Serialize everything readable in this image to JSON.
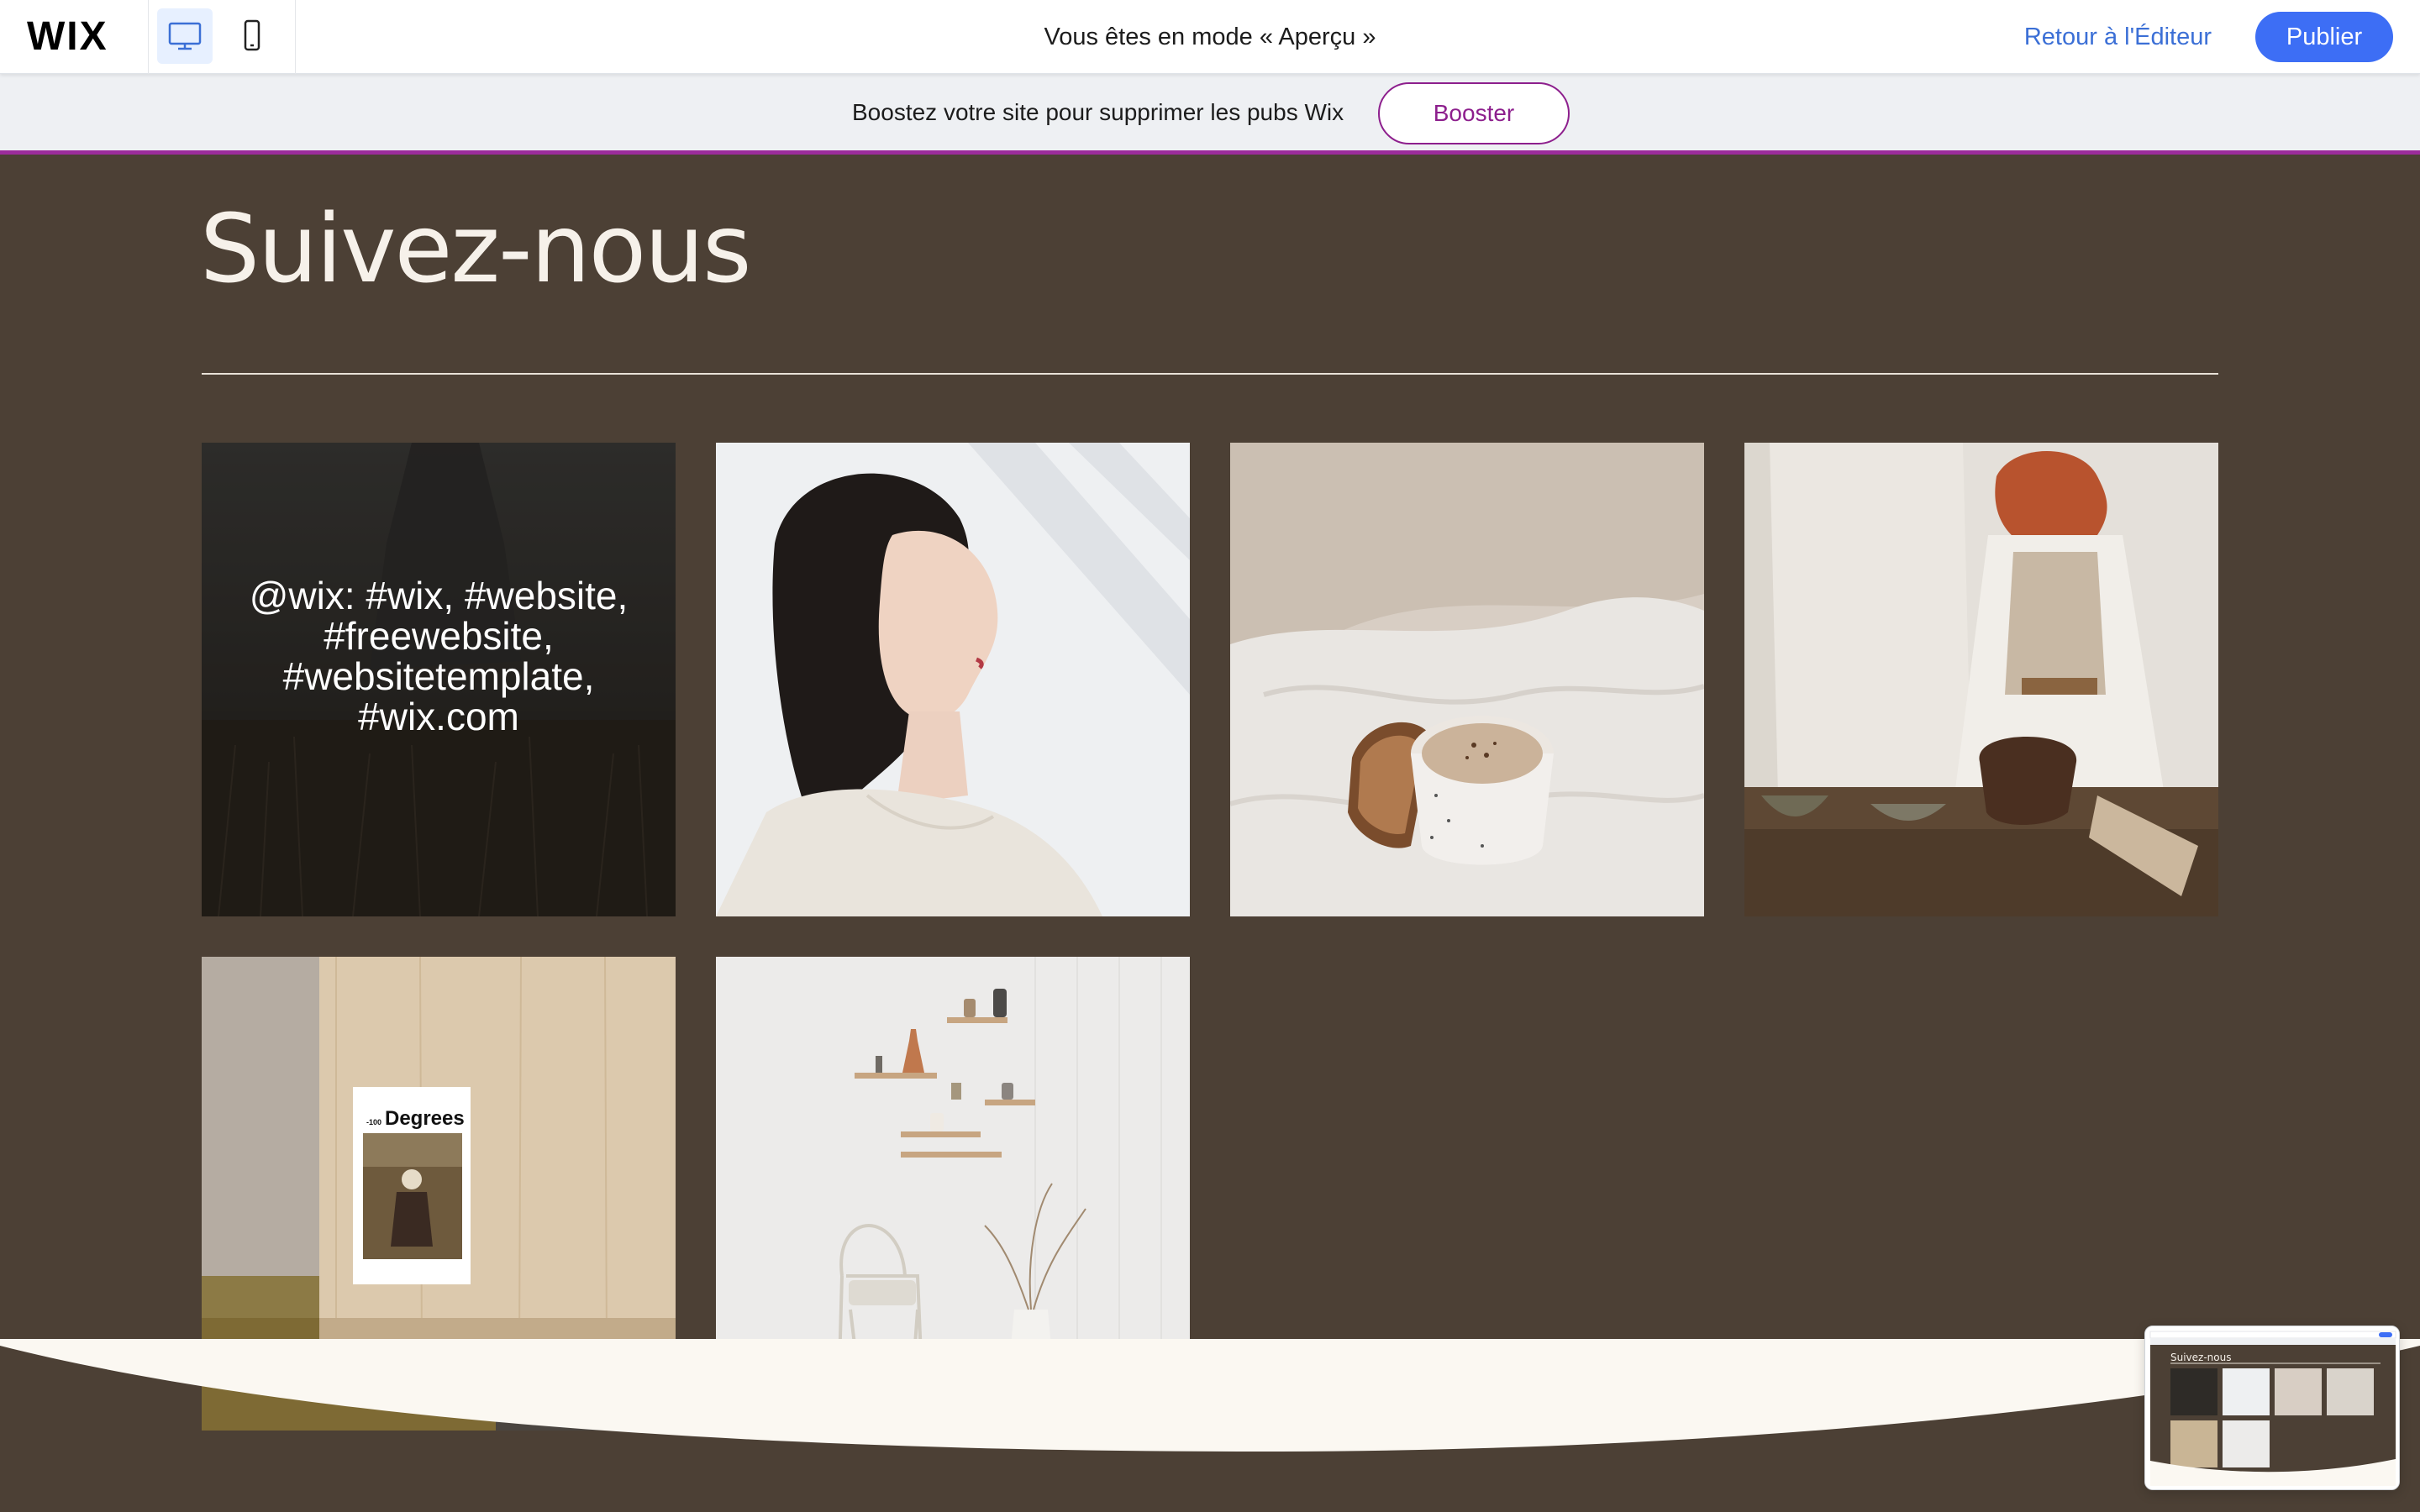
{
  "topbar": {
    "logo": "WIX",
    "mode_text": "Vous êtes en mode « Aperçu »",
    "back_label": "Retour à l'Éditeur",
    "publish_label": "Publier",
    "devices": [
      {
        "name": "desktop-icon",
        "selected": true
      },
      {
        "name": "mobile-icon",
        "selected": false
      }
    ],
    "accent": "#3d6ef5"
  },
  "promo": {
    "text": "Boostez votre site pour supprimer les pubs Wix",
    "button_label": "Booster",
    "accent": "#8d1f8d"
  },
  "site": {
    "title": "Suivez-nous",
    "background": "#4c4035",
    "footer_background": "#fbf8f2",
    "gallery": [
      {
        "name": "post-wheat-field",
        "overlay_text": "@wix: #wix, #website, #freewebsite, #websitetemplate, #wix.com"
      },
      {
        "name": "post-woman-profile"
      },
      {
        "name": "post-coffee-in-bed"
      },
      {
        "name": "post-couple-with-pottery"
      },
      {
        "name": "post-magazine-on-table",
        "magazine_title": "Degrees",
        "magazine_prefix": "-100"
      },
      {
        "name": "post-shelves-and-chair"
      }
    ]
  },
  "mini_preview": {
    "title": "Suivez-nous"
  }
}
